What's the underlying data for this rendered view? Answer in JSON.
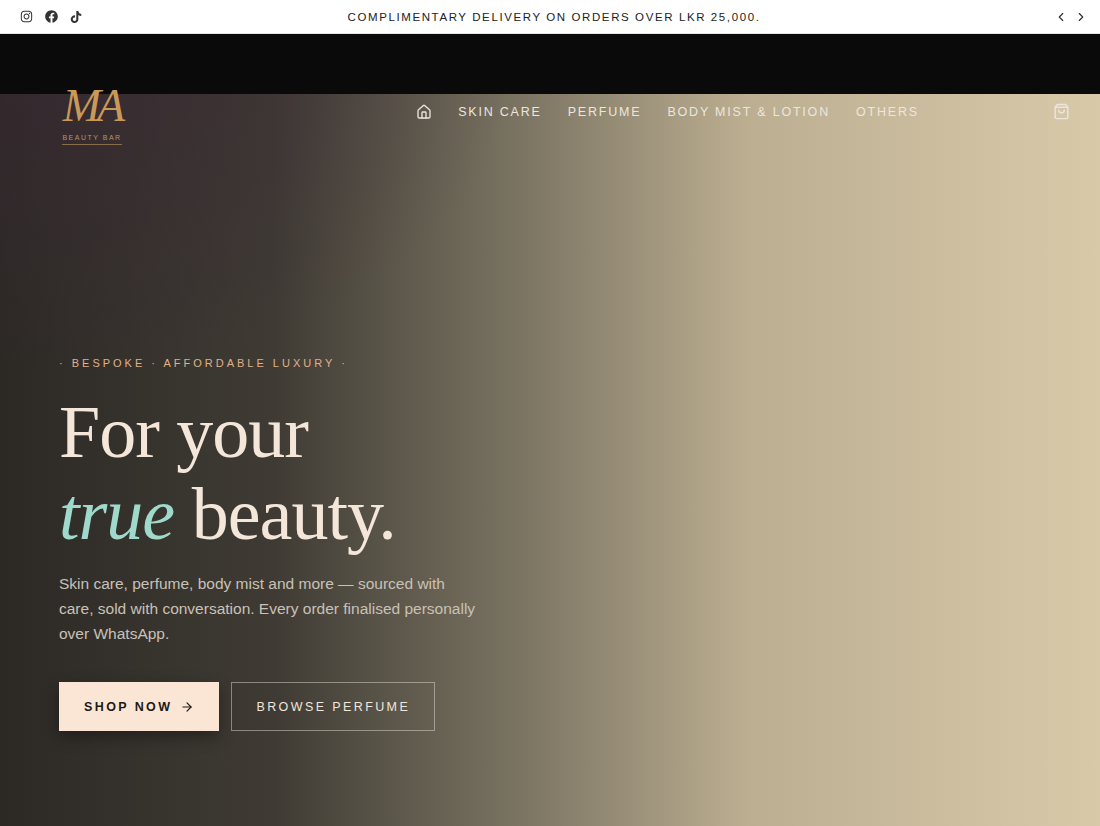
{
  "announcement": {
    "text": "COMPLIMENTARY DELIVERY ON ORDERS OVER LKR 25,000."
  },
  "logo": {
    "monogram": "MA",
    "tagline": "BEAUTY BAR"
  },
  "nav": [
    {
      "label": "SKIN CARE"
    },
    {
      "label": "PERFUME"
    },
    {
      "label": "BODY MIST & LOTION"
    },
    {
      "label": "OTHERS"
    }
  ],
  "hero": {
    "eyebrow": "· BESPOKE · AFFORDABLE LUXURY ·",
    "heading_line1": "For your",
    "heading_accent": "true",
    "heading_rest": "beauty.",
    "body": "Skin care, perfume, body mist and more — sourced with care, sold with conversation. Every order finalised personally over WhatsApp.",
    "buttons": [
      {
        "label": "SHOP NOW",
        "kind": "primary"
      },
      {
        "label": "BROWSE PERFUME",
        "kind": "outline"
      }
    ]
  }
}
